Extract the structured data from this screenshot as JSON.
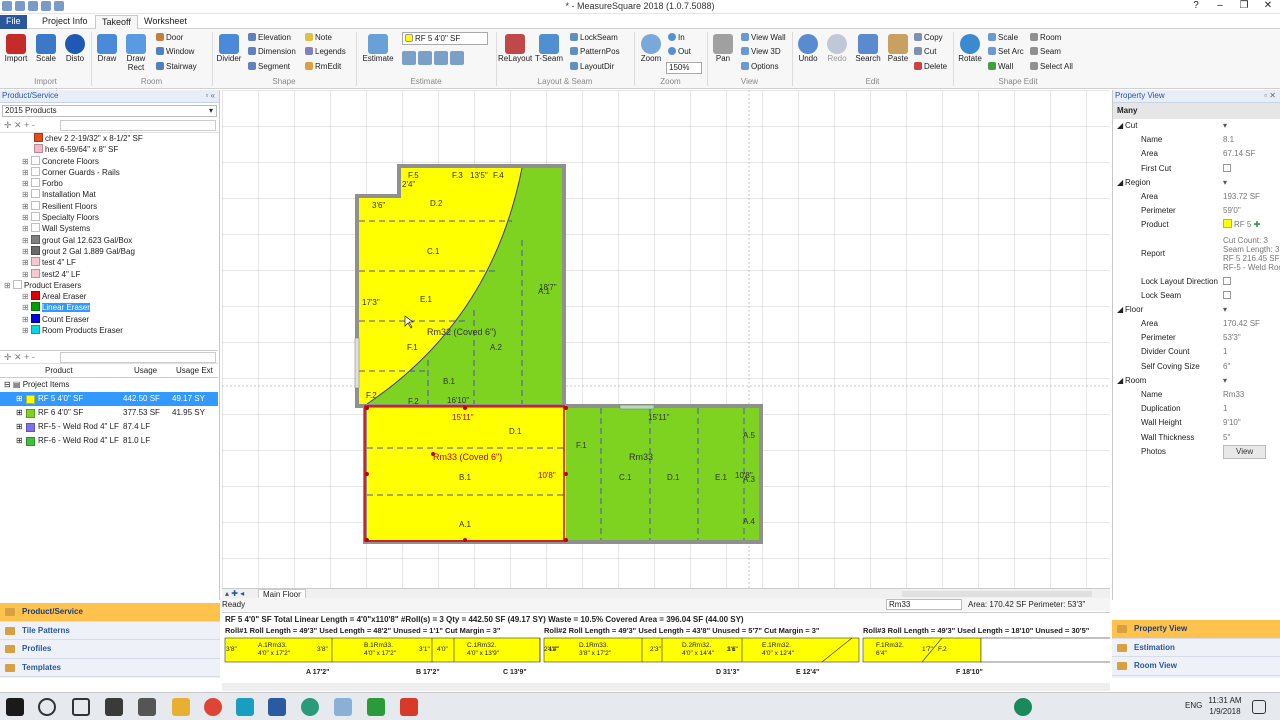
{
  "window": {
    "title": "* - MeasureSquare 2018 (1.0.7.5088)"
  },
  "tabs": [
    "File",
    "Project Info",
    "Takeoff",
    "Worksheet"
  ],
  "ribbon": {
    "big": [
      {
        "label": "Import"
      },
      {
        "label": "Scale"
      },
      {
        "label": "Disto"
      },
      {
        "label": "Draw"
      },
      {
        "label": "Draw Rect"
      },
      {
        "label": "Divider"
      },
      {
        "label": "Estimate"
      },
      {
        "label": "ReLayout"
      },
      {
        "label": "T-Seam"
      },
      {
        "label": "Zoom"
      },
      {
        "label": "Pan"
      },
      {
        "label": "Undo"
      },
      {
        "label": "Redo"
      },
      {
        "label": "Search"
      },
      {
        "label": "Paste"
      },
      {
        "label": "Rotate"
      }
    ],
    "small": {
      "door": "Door",
      "window": "Window",
      "stairway": "Stairway",
      "elevation": "Elevation",
      "dimension": "Dimension",
      "segment": "Segment",
      "note": "Note",
      "legends": "Legends",
      "rmedit": "RmEdit",
      "lockseam": "LockSeam",
      "patternpos": "PatternPos",
      "layoutdir": "LayoutDir",
      "zin": "In",
      "zout": "Out",
      "zoom_pct": "150%",
      "viewwall": "View Wall",
      "view3d": "View 3D",
      "options": "Options",
      "copy": "Copy",
      "cut": "Cut",
      "delete": "Delete",
      "scale": "Scale",
      "setarc": "Set Arc",
      "wall": "Wall",
      "room": "Room",
      "seam": "Seam",
      "selectall": "Select All"
    },
    "product_select": "RF 5 4'0\" SF",
    "groups": [
      "Import",
      "Room",
      "Shape",
      "Estimate",
      "Layout & Seam",
      "Zoom",
      "View",
      "Edit",
      "Shape Edit"
    ]
  },
  "product_panel": {
    "title": "Product/Service",
    "catalog": "2015 Products",
    "items": [
      {
        "label": "chev 2 2-19/32\" x 8-1/2\" SF",
        "color": "#e84a1a",
        "indent": 2
      },
      {
        "label": "hex 6-59/64\" x 8\" SF",
        "color": "#f6b8c8",
        "indent": 2
      },
      {
        "label": "Concrete Floors",
        "color": "#ffffff",
        "indent": 1
      },
      {
        "label": "Corner Guards - Rails",
        "color": "#ffffff",
        "indent": 1
      },
      {
        "label": "Forbo",
        "color": "#ffffff",
        "indent": 1
      },
      {
        "label": "Installation Mat",
        "color": "#ffffff",
        "indent": 1
      },
      {
        "label": "Resilient Floors",
        "color": "#ffffff",
        "indent": 1
      },
      {
        "label": "Specialty Floors",
        "color": "#ffffff",
        "indent": 1
      },
      {
        "label": "Wall Systems",
        "color": "#ffffff",
        "indent": 1
      },
      {
        "label": "grout  Gal 12.623 Gal/Box",
        "color": "#808080",
        "indent": 1
      },
      {
        "label": "grout 2  Gal 1.889 Gal/Bag",
        "color": "#6a6a6a",
        "indent": 1
      },
      {
        "label": "test 4\" LF",
        "color": "#f8c8d0",
        "indent": 1
      },
      {
        "label": "test2 4\" LF",
        "color": "#f8c8d0",
        "indent": 1
      },
      {
        "label": "Product Erasers",
        "color": "#ffffff",
        "indent": 0
      },
      {
        "label": "Areal Eraser",
        "color": "#e00000",
        "indent": 1
      },
      {
        "label": "Linear Eraser",
        "color": "#00a000",
        "indent": 1,
        "selected": true
      },
      {
        "label": "Count Eraser",
        "color": "#0000e0",
        "indent": 1
      },
      {
        "label": "Room Products Eraser",
        "color": "#00d8e0",
        "indent": 1
      }
    ]
  },
  "usage_grid": {
    "headers": [
      "Product",
      "Usage",
      "Usage Ext"
    ],
    "group": "Project Items",
    "rows": [
      {
        "name": "RF 5 4'0\" SF",
        "color": "#ffff00",
        "usage": "442.50 SF",
        "ext": "49.17 SY",
        "selected": true
      },
      {
        "name": "RF 6 4'0\" SF",
        "color": "#7ed321",
        "usage": "377.53 SF",
        "ext": "41.95 SY"
      },
      {
        "name": "RF-5 - Weld Rod 4\" LF",
        "color": "#8070f0",
        "usage": "87.4 LF",
        "ext": ""
      },
      {
        "name": "RF-6 - Weld Rod 4\" LF",
        "color": "#40c040",
        "usage": "81.0 LF",
        "ext": ""
      }
    ]
  },
  "left_nav": [
    "Product/Service",
    "Tile Patterns",
    "Profiles",
    "Templates"
  ],
  "canvas_labels": {
    "rm32": "Rm32 (Coved 6\")",
    "rm33a": "Rm33 (Coved 6\")",
    "rm33b": "Rm33",
    "d1": "17'3\"",
    "d2": "3'6\"",
    "d3": "2'4\"",
    "d4": "16'10\"",
    "d5": "15'11\"",
    "d6": "15'11\"",
    "d7": "10'8\"",
    "d8": "18'7\"",
    "d9": "10'8\"",
    "tags": [
      "F.5",
      "F.3",
      "13'5\"",
      "F.4",
      "D.2",
      "C.1",
      "E.1",
      "F.1",
      "A.1",
      "A.2",
      "B.1",
      "F.2",
      "F.2",
      "D.1",
      "B.1",
      "A.1",
      "F.1",
      "C.1",
      "D.1",
      "E.1",
      "A.5",
      "A.3",
      "A.4"
    ]
  },
  "sheet_tab": "Main Floor",
  "status": {
    "left": "Ready",
    "room": "Rm33",
    "area": "Area: 170.42 SF Perimeter: 53'3\""
  },
  "report": {
    "summary": "RF 5 4'0\" SF  Total Linear Length = 4'0\"x110'8\"  #Roll(s) = 3  Qty = 442.50 SF (49.17 SY)   Waste = 10.5%  Covered Area = 396.04 SF (44.00 SY)",
    "rolls": [
      "Roll#1 Roll Length = 49'3\" Used Length = 48'2\" Unused = 1'1\" Cut Margin = 3\"",
      "Roll#2 Roll Length = 49'3\" Used Length = 43'8\" Unused = 5'7\" Cut Margin = 3\"",
      "Roll#3 Roll Length = 49'3\" Used Length = 18'10\" Unused = 30'5\""
    ],
    "cuts": [
      "3'8\"",
      "A.1Rm33.\n4'0\" x 17'2\"",
      "3'8\"",
      "B.1Rm33.\n4'0\" x 17'2\"",
      "3'1\"",
      "4'0\"",
      "C.1Rm32.\n4'0\" x 13'9\"",
      "4'4\"",
      "2'11\"",
      "D.1Rm33.\n3'8\" x 17'2\"",
      "2'3\"",
      "D.2Rm32.\n4'0\" x 14'4\"",
      "1'6\"",
      "3'1\"",
      "E.1Rm32.\n4'0\" x 12'4\"",
      "F.1Rm32.\n6'4\"",
      "1'7\"",
      "F.2"
    ],
    "cut_labels": [
      "A 17'2\"",
      "B 17'2\"",
      "C 13'9\"",
      "D 31'3\"",
      "E 12'4\"",
      "F 18'10\""
    ]
  },
  "property_view": {
    "title": "Property View",
    "selection": "Many",
    "sections": [
      {
        "name": "Cut",
        "rows": [
          [
            "Name",
            "8.1"
          ],
          [
            "Area",
            "67.14 SF"
          ],
          [
            "First Cut",
            ""
          ]
        ]
      },
      {
        "name": "Region",
        "rows": [
          [
            "Area",
            "193.72 SF"
          ],
          [
            "Perimeter",
            "59'0\""
          ],
          [
            "Product",
            "RF 5"
          ],
          [
            "Report",
            "Cut Count: 3\nSeam Length: 33\nRF 5 216.45 SF\nRF-5 - Weld Roc"
          ],
          [
            "Lock Layout Direction",
            ""
          ],
          [
            "Lock Seam",
            ""
          ]
        ]
      },
      {
        "name": "Floor",
        "rows": [
          [
            "Area",
            "170.42 SF"
          ],
          [
            "Perimeter",
            "53'3\""
          ],
          [
            "Divider Count",
            "1"
          ],
          [
            "Self Coving Size",
            "6\""
          ]
        ]
      },
      {
        "name": "Room",
        "rows": [
          [
            "Name",
            "Rm33"
          ],
          [
            "Duplication",
            "1"
          ],
          [
            "Wall Height",
            "9'10\""
          ],
          [
            "Wall Thickness",
            "5\""
          ],
          [
            "Photos",
            "View"
          ]
        ]
      }
    ]
  },
  "right_nav": [
    "Property View",
    "Estimation",
    "Room View"
  ],
  "taskbar": {
    "time": "11:31 AM",
    "date": "1/9/2018",
    "lang": "ENG"
  }
}
